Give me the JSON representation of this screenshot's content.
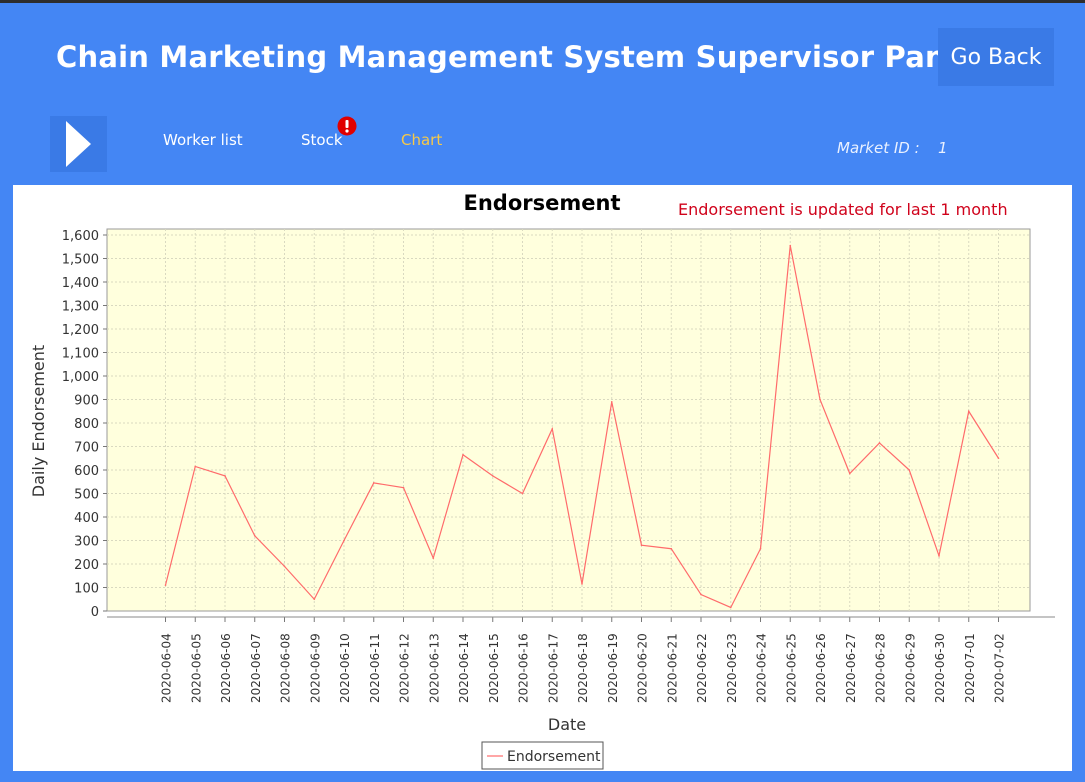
{
  "header": {
    "title": "Chain Marketing Management System Supervisor Panel",
    "go_back_label": "Go Back"
  },
  "nav": {
    "items": [
      {
        "label": "Worker list"
      },
      {
        "label": "Stock"
      },
      {
        "label": "Chart",
        "active": true
      }
    ],
    "stock_alert_icon": "exclamation-alert-icon",
    "market_label": "Market ID :",
    "market_id": "1"
  },
  "colors": {
    "background": "#4486f4",
    "button": "#3a7ae6",
    "active_tab": "#f7c948",
    "alert": "#e00000",
    "plot_background": "#ffffdd",
    "series": "#ff6b6b",
    "notice": "#d0021b"
  },
  "chart_notice": "Endorsement is updated for last 1 month",
  "chart_data": {
    "type": "line",
    "title": "Endorsement",
    "xlabel": "Date",
    "ylabel": "Daily Endorsement",
    "ylim": [
      0,
      1600
    ],
    "ytick_step": 100,
    "grid": true,
    "legend": "bottom-center",
    "categories": [
      "2020-06-04",
      "2020-06-05",
      "2020-06-06",
      "2020-06-07",
      "2020-06-08",
      "2020-06-09",
      "2020-06-10",
      "2020-06-11",
      "2020-06-12",
      "2020-06-13",
      "2020-06-14",
      "2020-06-15",
      "2020-06-16",
      "2020-06-17",
      "2020-06-18",
      "2020-06-19",
      "2020-06-20",
      "2020-06-21",
      "2020-06-22",
      "2020-06-23",
      "2020-06-24",
      "2020-06-25",
      "2020-06-26",
      "2020-06-27",
      "2020-06-28",
      "2020-06-29",
      "2020-06-30",
      "2020-07-01",
      "2020-07-02"
    ],
    "series": [
      {
        "name": "Endorsement",
        "values": [
          110,
          615,
          575,
          320,
          190,
          50,
          300,
          545,
          525,
          225,
          665,
          575,
          500,
          775,
          115,
          890,
          280,
          265,
          70,
          15,
          265,
          1555,
          900,
          585,
          715,
          600,
          235,
          850,
          650
        ]
      }
    ]
  }
}
